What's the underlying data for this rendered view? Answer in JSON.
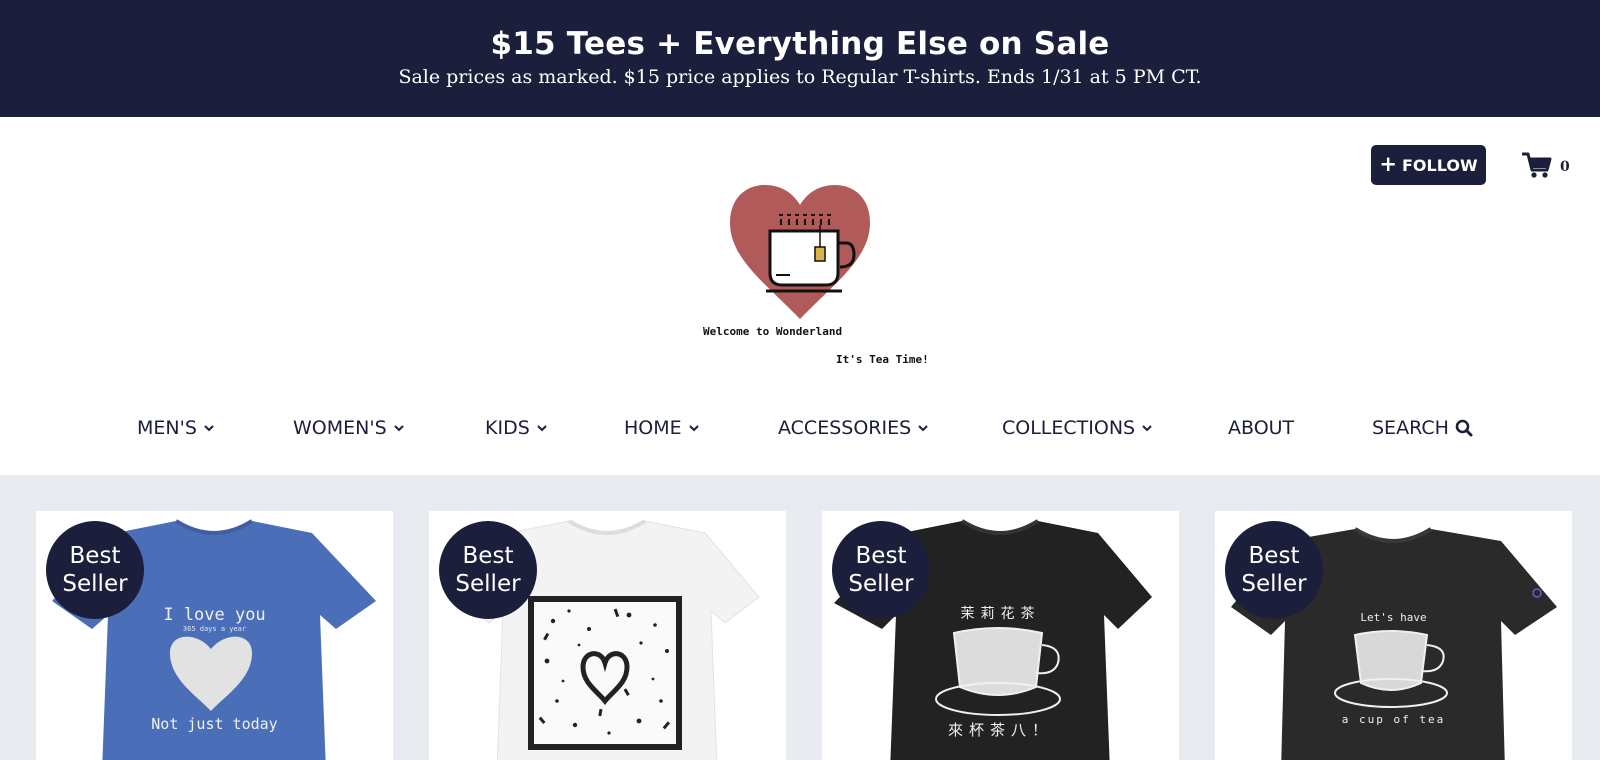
{
  "promo": {
    "title": "$15 Tees + Everything Else on Sale",
    "subtitle": "Sale prices as marked. $15 price applies to Regular T-shirts. Ends 1/31 at 5 PM CT."
  },
  "header": {
    "follow_label": "FOLLOW",
    "follow_icon": "plus-icon",
    "cart_icon": "cart-icon",
    "cart_count": "0",
    "logo": {
      "line1": "Welcome to Wonderland",
      "line2": "It's Tea Time!",
      "heart_color": "#b05a5a"
    }
  },
  "nav": {
    "items": [
      {
        "label": "MEN'S",
        "dropdown": true
      },
      {
        "label": "WOMEN'S",
        "dropdown": true
      },
      {
        "label": "KIDS",
        "dropdown": true
      },
      {
        "label": "HOME",
        "dropdown": true
      },
      {
        "label": "ACCESSORIES",
        "dropdown": true
      },
      {
        "label": "COLLECTIONS",
        "dropdown": true
      },
      {
        "label": "ABOUT",
        "dropdown": false
      },
      {
        "label": "SEARCH",
        "icon": "search-icon"
      }
    ]
  },
  "products": [
    {
      "badge": "Best Seller",
      "badge_line1": "Best",
      "badge_line2": "Seller",
      "shirt_color": "#4a6fb8",
      "print_lines": [
        "I love you",
        "365 days a year",
        "Not just today"
      ]
    },
    {
      "badge": "Best Seller",
      "badge_line1": "Best",
      "badge_line2": "Seller",
      "shirt_color": "#f2f2f2",
      "print_lines": []
    },
    {
      "badge": "Best Seller",
      "badge_line1": "Best",
      "badge_line2": "Seller",
      "shirt_color": "#222222",
      "print_lines": [
        "茉莉花茶",
        "來杯茶八！"
      ]
    },
    {
      "badge": "Best Seller",
      "badge_line1": "Best",
      "badge_line2": "Seller",
      "shirt_color": "#2a2a2a",
      "print_lines": [
        "Let's have",
        "a cup of tea"
      ]
    }
  ],
  "colors": {
    "navy": "#1c1f3b",
    "products_bg": "#e8ebf0"
  }
}
